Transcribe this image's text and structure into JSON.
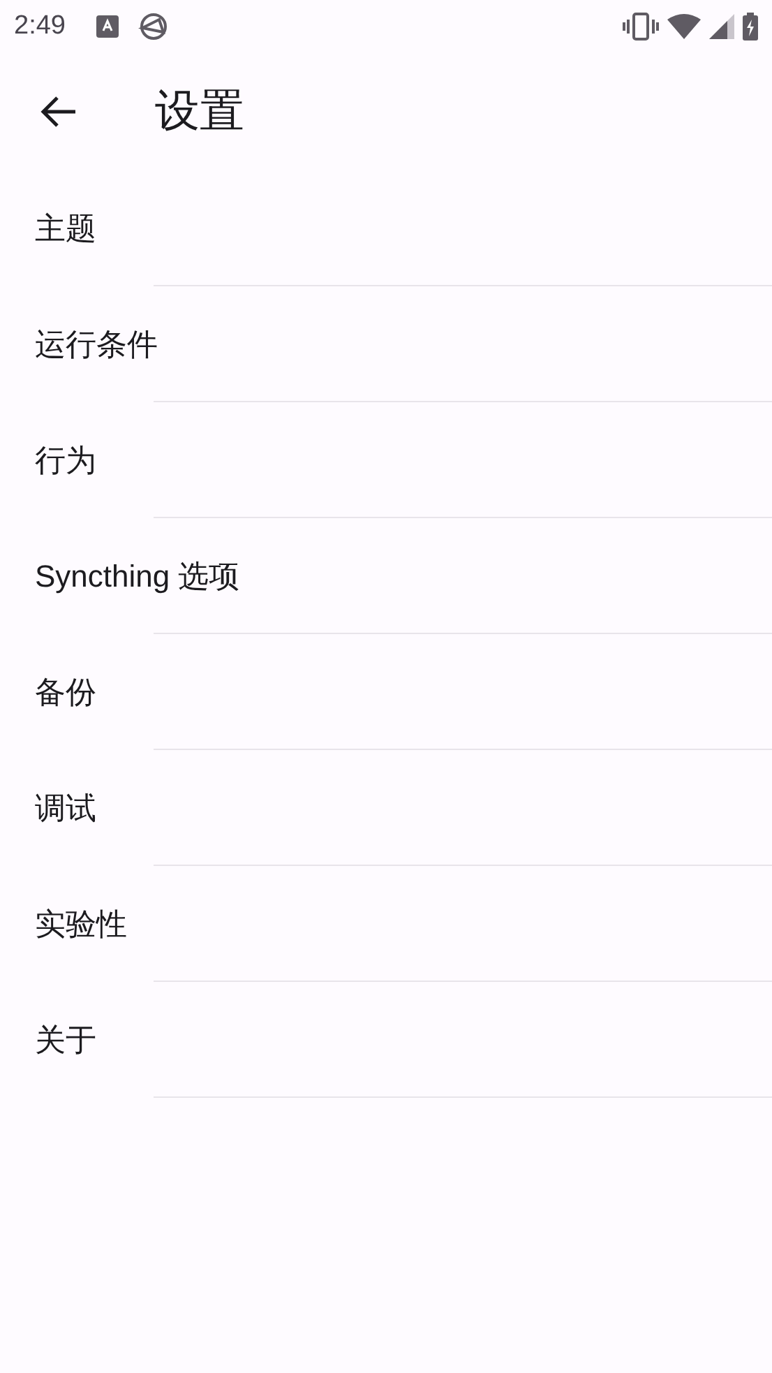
{
  "status_bar": {
    "time": "2:49"
  },
  "app_bar": {
    "title": "设置"
  },
  "items": [
    {
      "label": "主题"
    },
    {
      "label": "运行条件"
    },
    {
      "label": "行为"
    },
    {
      "label": "Syncthing 选项"
    },
    {
      "label": "备份"
    },
    {
      "label": "调试"
    },
    {
      "label": "实验性"
    },
    {
      "label": "关于"
    }
  ]
}
